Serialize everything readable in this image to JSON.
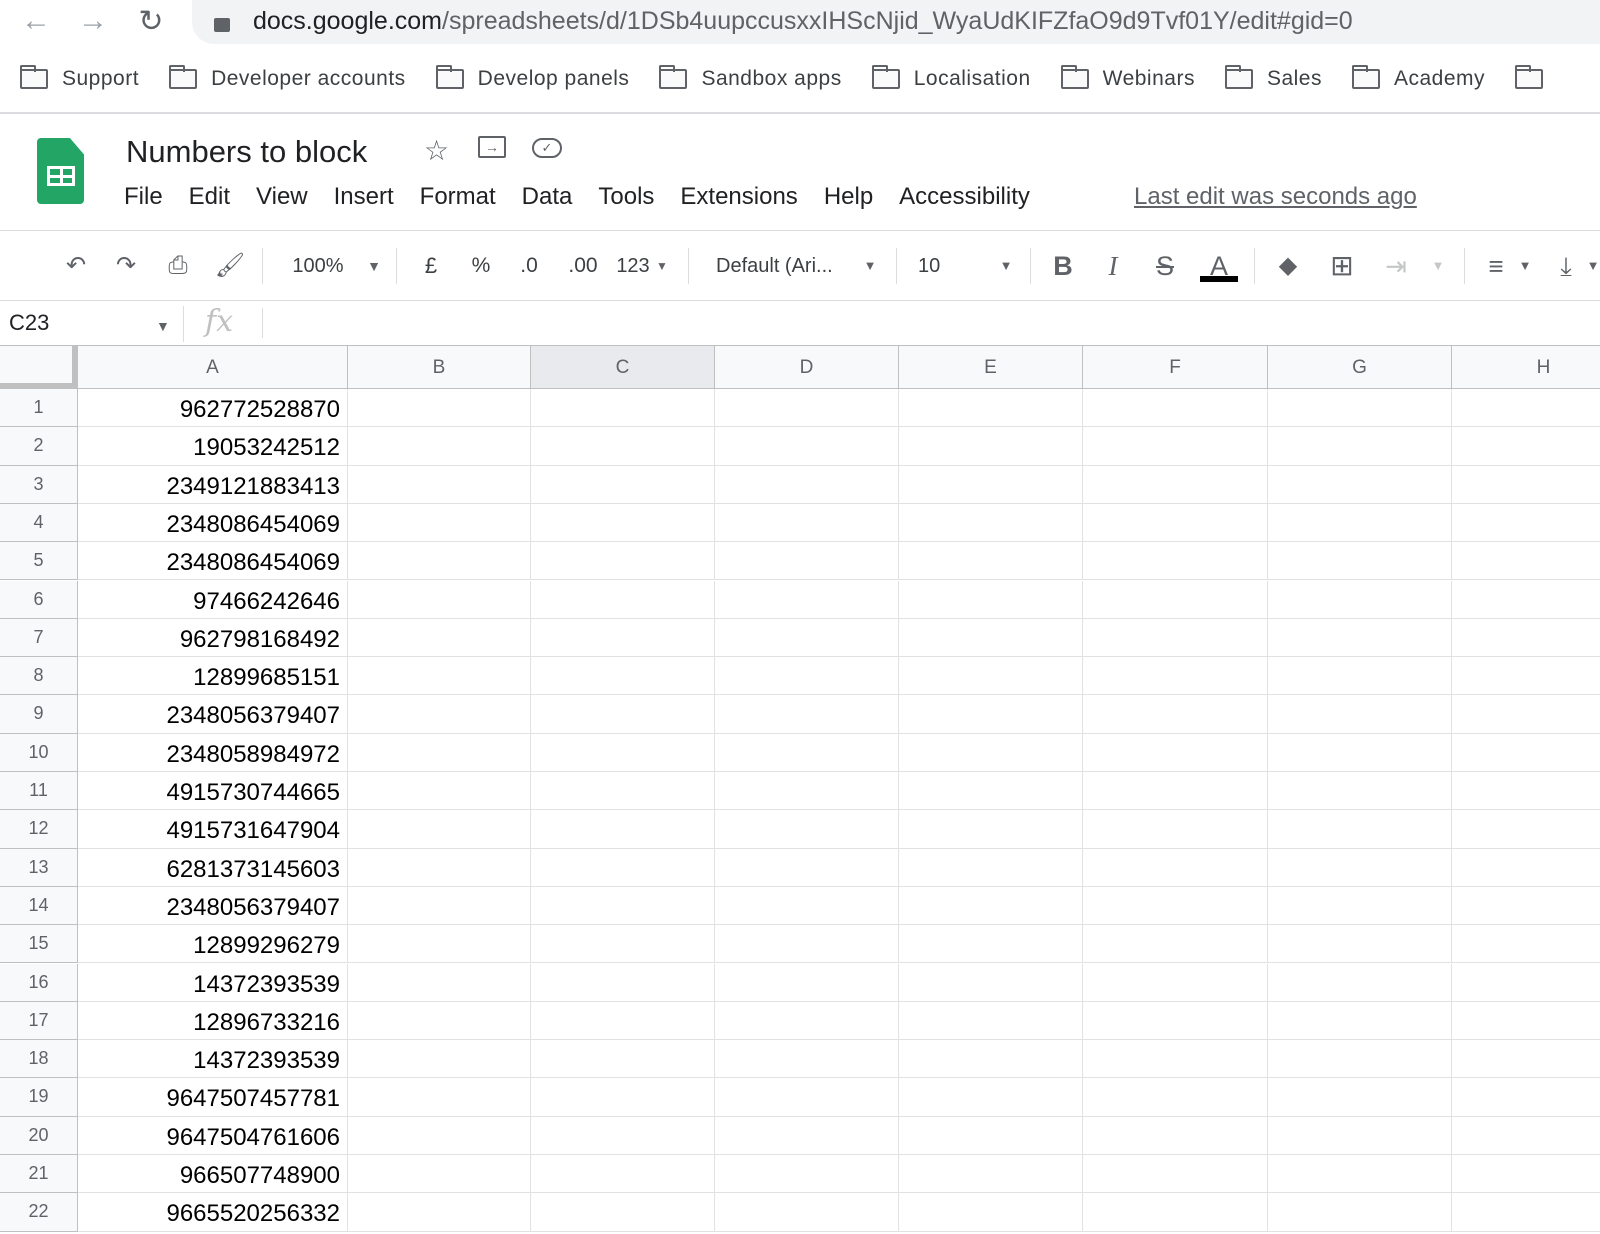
{
  "browser": {
    "url_host": "docs.google.com",
    "url_path": "/spreadsheets/d/1DSb4uupccusxxIHScNjid_WyaUdKIFZfaO9d9Tvf01Y/edit#gid=0",
    "bookmarks": [
      "Support",
      "Developer accounts",
      "Develop panels",
      "Sandbox apps",
      "Localisation",
      "Webinars",
      "Sales",
      "Academy"
    ]
  },
  "doc": {
    "title": "Numbers to block",
    "last_edit": "Last edit was seconds ago",
    "menu": [
      "File",
      "Edit",
      "View",
      "Insert",
      "Format",
      "Data",
      "Tools",
      "Extensions",
      "Help",
      "Accessibility"
    ]
  },
  "toolbar": {
    "zoom": "100%",
    "currency": "£",
    "percent": "%",
    "dec_less": ".0",
    "dec_more": ".00",
    "format": "123",
    "font": "Default (Ari...",
    "font_size": "10",
    "bold": "B",
    "italic": "I",
    "strike": "S",
    "text_color": "A",
    "text_color_value": "#000000"
  },
  "formula_bar": {
    "name_box": "C23",
    "fx": "fx",
    "value": ""
  },
  "sheet": {
    "columns": [
      "A",
      "B",
      "C",
      "D",
      "E",
      "F",
      "G",
      "H"
    ],
    "selected_column": "C",
    "rows": [
      {
        "n": "1",
        "a": "962772528870"
      },
      {
        "n": "2",
        "a": "19053242512"
      },
      {
        "n": "3",
        "a": "2349121883413"
      },
      {
        "n": "4",
        "a": "2348086454069"
      },
      {
        "n": "5",
        "a": "2348086454069"
      },
      {
        "n": "6",
        "a": "97466242646"
      },
      {
        "n": "7",
        "a": "962798168492"
      },
      {
        "n": "8",
        "a": "12899685151"
      },
      {
        "n": "9",
        "a": "2348056379407"
      },
      {
        "n": "10",
        "a": "2348058984972"
      },
      {
        "n": "11",
        "a": "4915730744665"
      },
      {
        "n": "12",
        "a": "4915731647904"
      },
      {
        "n": "13",
        "a": "6281373145603"
      },
      {
        "n": "14",
        "a": "2348056379407"
      },
      {
        "n": "15",
        "a": "12899296279"
      },
      {
        "n": "16",
        "a": "14372393539"
      },
      {
        "n": "17",
        "a": "12896733216"
      },
      {
        "n": "18",
        "a": "14372393539"
      },
      {
        "n": "19",
        "a": "9647507457781"
      },
      {
        "n": "20",
        "a": "9647504761606"
      },
      {
        "n": "21",
        "a": "966507748900"
      },
      {
        "n": "22",
        "a": "9665520256332"
      }
    ]
  }
}
